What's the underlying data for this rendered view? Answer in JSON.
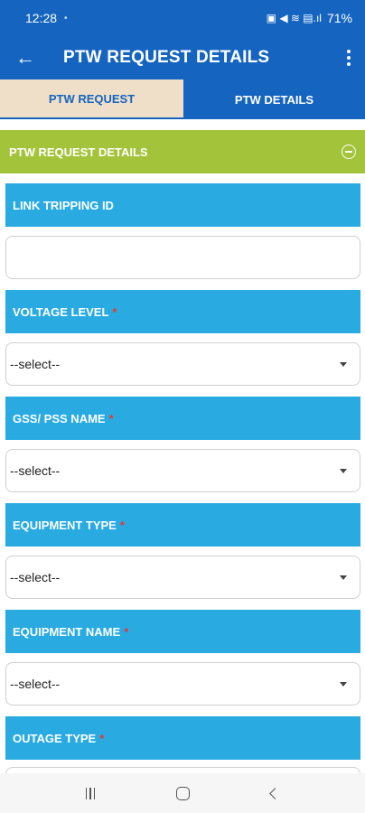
{
  "status_bar": {
    "time": "12:28",
    "notification_dot": "•",
    "indicators": "▣ ◀ ≋ ▤.ıl",
    "battery_percent": "71%"
  },
  "app_bar": {
    "back_icon": "←",
    "title": "PTW REQUEST DETAILS"
  },
  "tabs": [
    {
      "label": "PTW REQUEST",
      "active": true
    },
    {
      "label": "PTW DETAILS",
      "active": false
    }
  ],
  "section": {
    "title": "PTW REQUEST DETAILS"
  },
  "form": {
    "link_tripping_id": {
      "label": "LINK TRIPPING ID",
      "value": "",
      "placeholder": ""
    },
    "voltage_level": {
      "label": "VOLTAGE LEVEL",
      "required_mark": "*",
      "selected": "--select--"
    },
    "gss_pss_name": {
      "label": "GSS/ PSS NAME",
      "required_mark": "*",
      "selected": "--select--"
    },
    "equipment_type": {
      "label": "EQUIPMENT TYPE",
      "required_mark": "*",
      "selected": "--select--"
    },
    "equipment_name": {
      "label": "EQUIPMENT NAME",
      "required_mark": "*",
      "selected": "--select--"
    },
    "outage_type": {
      "label": "OUTAGE TYPE",
      "required_mark": "*",
      "selected": ""
    }
  },
  "colors": {
    "primary": "#1565c0",
    "active_tab_bg": "#efdfc8",
    "section_header": "#a3c43a",
    "label_bar": "#29abe2",
    "required": "#e53935"
  },
  "icons": {
    "back": "arrow-left-icon",
    "menu": "more-vertical-icon",
    "collapse": "minus-circle-icon",
    "dropdown": "caret-down-icon",
    "nav_recents": "recents-icon",
    "nav_home": "home-icon",
    "nav_back": "back-chevron-icon"
  }
}
